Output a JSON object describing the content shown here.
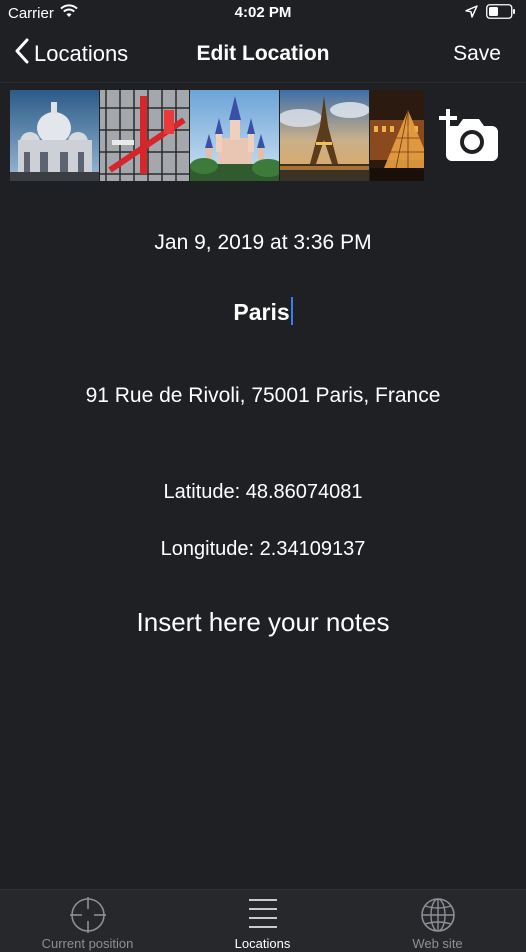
{
  "status_bar": {
    "carrier": "Carrier",
    "time": "4:02 PM"
  },
  "nav": {
    "back_label": "Locations",
    "title": "Edit Location",
    "save_label": "Save"
  },
  "photos": [
    {
      "subject": "Sacré-Cœur basilica"
    },
    {
      "subject": "Centre Pompidou"
    },
    {
      "subject": "Disneyland castle"
    },
    {
      "subject": "Eiffel Tower"
    },
    {
      "subject": "Louvre pyramid"
    }
  ],
  "location": {
    "date": "Jan 9, 2019 at 3:36 PM",
    "name": "Paris",
    "address": "91 Rue de Rivoli, 75001 Paris, France",
    "latitude": "Latitude: 48.86074081",
    "longitude": "Longitude: 2.34109137",
    "notes_placeholder": "Insert here your notes"
  },
  "tabs": [
    {
      "label": "Current position",
      "icon": "crosshair-icon",
      "active": false
    },
    {
      "label": "Locations",
      "icon": "list-icon",
      "active": true
    },
    {
      "label": "Web site",
      "icon": "globe-icon",
      "active": false
    }
  ],
  "colors": {
    "background": "#1f2024",
    "tab_bar": "#27282c",
    "caret": "#3c7cf0",
    "inactive_tab": "#8e8f94"
  }
}
